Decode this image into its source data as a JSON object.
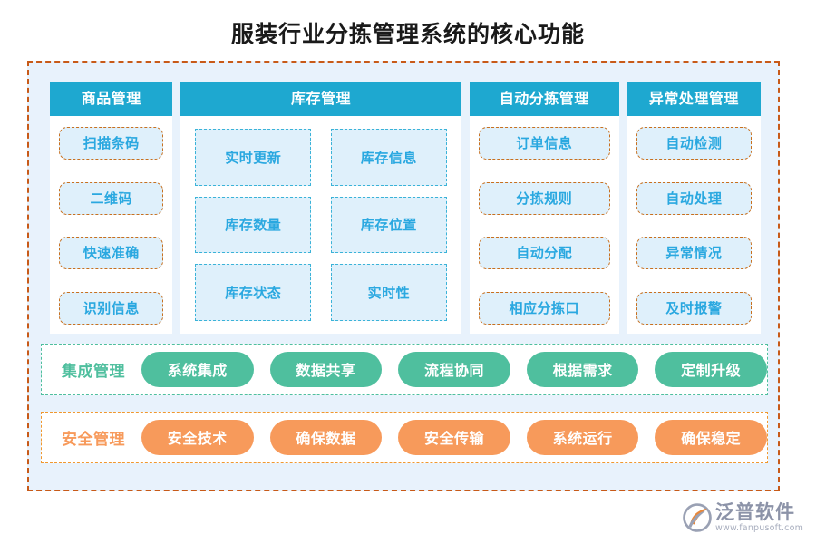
{
  "title": "服装行业分拣管理系统的核心功能",
  "colors": {
    "header_blue": "#1EA8D0",
    "chip_text_blue": "#2AA8E0",
    "chip_fill_blue": "#DFF0FB",
    "chip_border_orange": "#C8701F",
    "chip_border_teal": "#3BB3D8",
    "band_green": "#4FBF9E",
    "band_orange": "#F79A5B",
    "outer_border_orange": "#C85A18",
    "page_bg": "#E8F2FC"
  },
  "columns": [
    {
      "header": "商品管理",
      "layout": "list",
      "items": [
        "扫描条码",
        "二维码",
        "快速准确",
        "识别信息"
      ]
    },
    {
      "header": "库存管理",
      "layout": "grid",
      "items": [
        "实时更新",
        "库存信息",
        "库存数量",
        "库存位置",
        "库存状态",
        "实时性"
      ]
    },
    {
      "header": "自动分拣管理",
      "layout": "list",
      "items": [
        "订单信息",
        "分拣规则",
        "自动分配",
        "相应分拣口"
      ]
    },
    {
      "header": "异常处理管理",
      "layout": "list",
      "items": [
        "自动检测",
        "自动处理",
        "异常情况",
        "及时报警"
      ]
    }
  ],
  "bands": [
    {
      "label": "集成管理",
      "style": "green",
      "pills": [
        "系统集成",
        "数据共享",
        "流程协同",
        "根据需求",
        "定制升级"
      ]
    },
    {
      "label": "安全管理",
      "style": "orange",
      "pills": [
        "安全技术",
        "确保数据",
        "安全传输",
        "系统运行",
        "确保稳定"
      ]
    }
  ],
  "logo": {
    "icon": "fanpu-swoosh-logo-icon",
    "name": "泛普软件",
    "url": "www.fanpusoft.com"
  }
}
